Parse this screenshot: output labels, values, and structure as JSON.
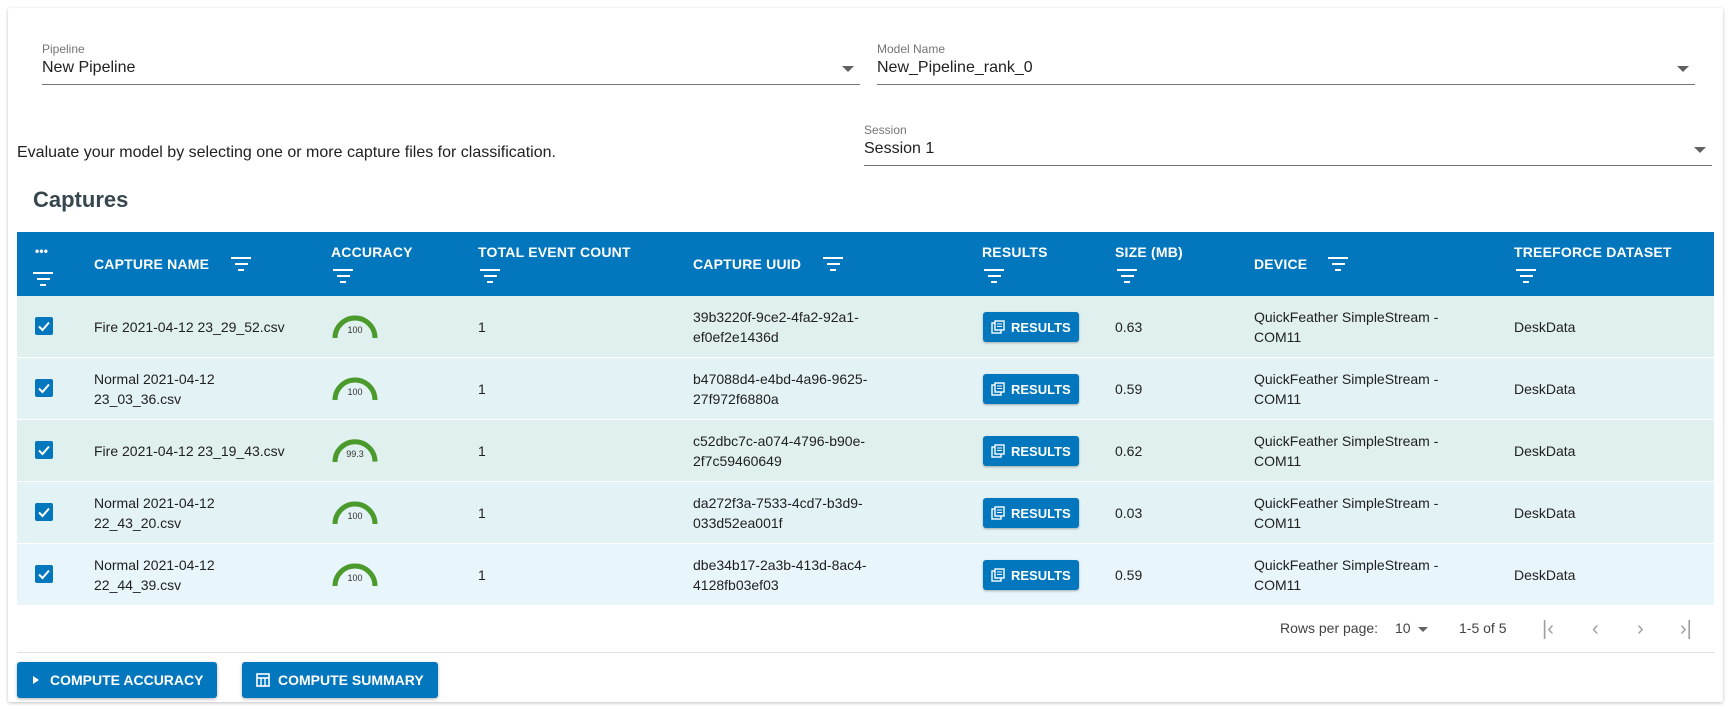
{
  "pipeline": {
    "label": "Pipeline",
    "value": "New Pipeline"
  },
  "model": {
    "label": "Model Name",
    "value": "New_Pipeline_rank_0"
  },
  "session": {
    "label": "Session",
    "value": "Session 1"
  },
  "instruction": "Evaluate your model by selecting one or more capture files for classification.",
  "captures_title": "Captures",
  "table": {
    "headers": {
      "more": "•••",
      "capture_name": "CAPTURE NAME",
      "accuracy": "ACCURACY",
      "total_event_count": "TOTAL EVENT COUNT",
      "capture_uuid": "CAPTURE UUID",
      "results": "RESULTS",
      "size": "SIZE (MB)",
      "device": "DEVICE",
      "treeforce_dataset": "TREEFORCE DATASET"
    },
    "results_button_label": "RESULTS",
    "rows": [
      {
        "name_l1": "Fire 2021-04-12 23_29_52.csv",
        "name_l2": "",
        "accuracy": "100",
        "accuracy_value": 100,
        "events": "1",
        "uuid_l1": "39b3220f-9ce2-4fa2-92a1-",
        "uuid_l2": "ef0ef2e1436d",
        "size": "0.63",
        "device_l1": "QuickFeather SimpleStream -",
        "device_l2": "COM11",
        "dataset": "DeskData",
        "checked": true
      },
      {
        "name_l1": "Normal 2021-04-12",
        "name_l2": "23_03_36.csv",
        "accuracy": "100",
        "accuracy_value": 100,
        "events": "1",
        "uuid_l1": "b47088d4-e4bd-4a96-9625-",
        "uuid_l2": "27f972f6880a",
        "size": "0.59",
        "device_l1": "QuickFeather SimpleStream -",
        "device_l2": "COM11",
        "dataset": "DeskData",
        "checked": true
      },
      {
        "name_l1": "Fire 2021-04-12 23_19_43.csv",
        "name_l2": "",
        "accuracy": "99.3",
        "accuracy_value": 99.3,
        "events": "1",
        "uuid_l1": "c52dbc7c-a074-4796-b90e-",
        "uuid_l2": "2f7c59460649",
        "size": "0.62",
        "device_l1": "QuickFeather SimpleStream -",
        "device_l2": "COM11",
        "dataset": "DeskData",
        "checked": true
      },
      {
        "name_l1": "Normal 2021-04-12",
        "name_l2": "22_43_20.csv",
        "accuracy": "100",
        "accuracy_value": 100,
        "events": "1",
        "uuid_l1": "da272f3a-7533-4cd7-b3d9-",
        "uuid_l2": "033d52ea001f",
        "size": "0.03",
        "device_l1": "QuickFeather SimpleStream -",
        "device_l2": "COM11",
        "dataset": "DeskData",
        "checked": true
      },
      {
        "name_l1": "Normal 2021-04-12",
        "name_l2": "22_44_39.csv",
        "accuracy": "100",
        "accuracy_value": 100,
        "events": "1",
        "uuid_l1": "dbe34b17-2a3b-413d-8ac4-",
        "uuid_l2": "4128fb03ef03",
        "size": "0.59",
        "device_l1": "QuickFeather SimpleStream -",
        "device_l2": "COM11",
        "dataset": "DeskData",
        "checked": true
      }
    ]
  },
  "pagination": {
    "rows_per_page_label": "Rows per page:",
    "rows_per_page_value": "10",
    "range": "1-5 of 5"
  },
  "actions": {
    "compute_accuracy": "COMPUTE ACCURACY",
    "compute_summary": "COMPUTE SUMMARY"
  },
  "colors": {
    "primary": "#0277bd",
    "gauge": "#4b9a2c",
    "row_tint": "#dff0ee"
  },
  "icons": {
    "filter": "filter-icon",
    "more": "more-horiz-icon",
    "results": "library-books-icon",
    "play": "play-arrow-icon",
    "summary": "table-chart-icon"
  }
}
